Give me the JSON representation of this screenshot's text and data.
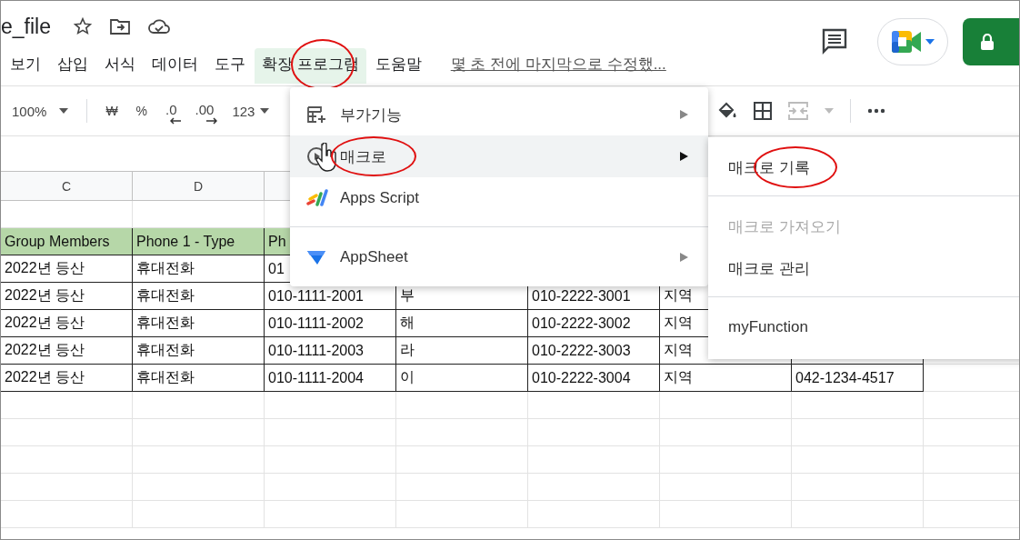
{
  "document": {
    "title": "e_file",
    "last_edit": "몇 초 전에 마지막으로 수정했..."
  },
  "menu_bar": [
    {
      "label": "보기",
      "selected": false,
      "circled": false
    },
    {
      "label": "삽입",
      "selected": false,
      "circled": false
    },
    {
      "label": "서식",
      "selected": false,
      "circled": false
    },
    {
      "label": "데이터",
      "selected": false,
      "circled": false
    },
    {
      "label": "도구",
      "selected": false,
      "circled": false
    },
    {
      "label": "확장 프로그램",
      "selected": true,
      "circled": true
    },
    {
      "label": "도움말",
      "selected": false,
      "circled": false
    }
  ],
  "toolbar": {
    "zoom": "100%",
    "buttons": [
      {
        "kind": "currency",
        "label": "₩"
      },
      {
        "kind": "percent",
        "label": "%"
      },
      {
        "kind": "decrease_decimal",
        "label": ".0"
      },
      {
        "kind": "increase_decimal",
        "label": ".00"
      },
      {
        "kind": "number_format",
        "label": "123"
      }
    ]
  },
  "columns": [
    {
      "label": "C"
    },
    {
      "label": "D"
    }
  ],
  "rows": [
    {
      "kind": "empty",
      "cells": []
    },
    {
      "kind": "header",
      "cells": [
        "Group Members",
        "Phone 1 - Type",
        "Ph"
      ]
    },
    {
      "kind": "data",
      "cells": [
        "2022년 등산",
        "휴대전화",
        "01"
      ]
    },
    {
      "kind": "data",
      "cells": [
        "2022년 등산",
        "휴대전화",
        "010-1111-2001",
        "부",
        "010-2222-3001",
        "지역"
      ]
    },
    {
      "kind": "data",
      "cells": [
        "2022년 등산",
        "휴대전화",
        "010-1111-2002",
        "해",
        "010-2222-3002",
        "지역"
      ]
    },
    {
      "kind": "data",
      "cells": [
        "2022년 등산",
        "휴대전화",
        "010-1111-2003",
        "라",
        "010-2222-3003",
        "지역"
      ]
    },
    {
      "kind": "data",
      "cells": [
        "2022년 등산",
        "휴대전화",
        "010-1111-2004",
        "이",
        "010-2222-3004",
        "지역",
        "042-1234-4517"
      ]
    },
    {
      "kind": "empty",
      "cells": []
    },
    {
      "kind": "empty",
      "cells": []
    },
    {
      "kind": "empty",
      "cells": []
    },
    {
      "kind": "empty",
      "cells": []
    },
    {
      "kind": "empty",
      "cells": []
    }
  ],
  "extensions_menu": {
    "groups": [
      {
        "items": [
          {
            "kind": "addons",
            "label": "부가기능",
            "submenu": true,
            "selected": false,
            "circled": false,
            "cursor": false
          },
          {
            "kind": "macros",
            "label": "매크로",
            "submenu": true,
            "selected": true,
            "circled": true,
            "cursor": true
          },
          {
            "kind": "apps_script",
            "label": "Apps Script",
            "submenu": false,
            "selected": false,
            "circled": false,
            "cursor": false
          }
        ]
      },
      {
        "items": [
          {
            "kind": "appsheet",
            "label": "AppSheet",
            "submenu": true,
            "selected": false,
            "circled": false,
            "cursor": false
          }
        ]
      }
    ]
  },
  "macros_submenu": {
    "groups": [
      {
        "items": [
          {
            "label": "매크로 기록",
            "disabled": false,
            "circled": true
          }
        ]
      },
      {
        "items": [
          {
            "label": "매크로 가져오기",
            "disabled": true,
            "circled": false
          },
          {
            "label": "매크로 관리",
            "disabled": false,
            "circled": false
          }
        ]
      },
      {
        "items": [
          {
            "label": "myFunction",
            "disabled": false,
            "circled": false
          }
        ]
      }
    ]
  }
}
